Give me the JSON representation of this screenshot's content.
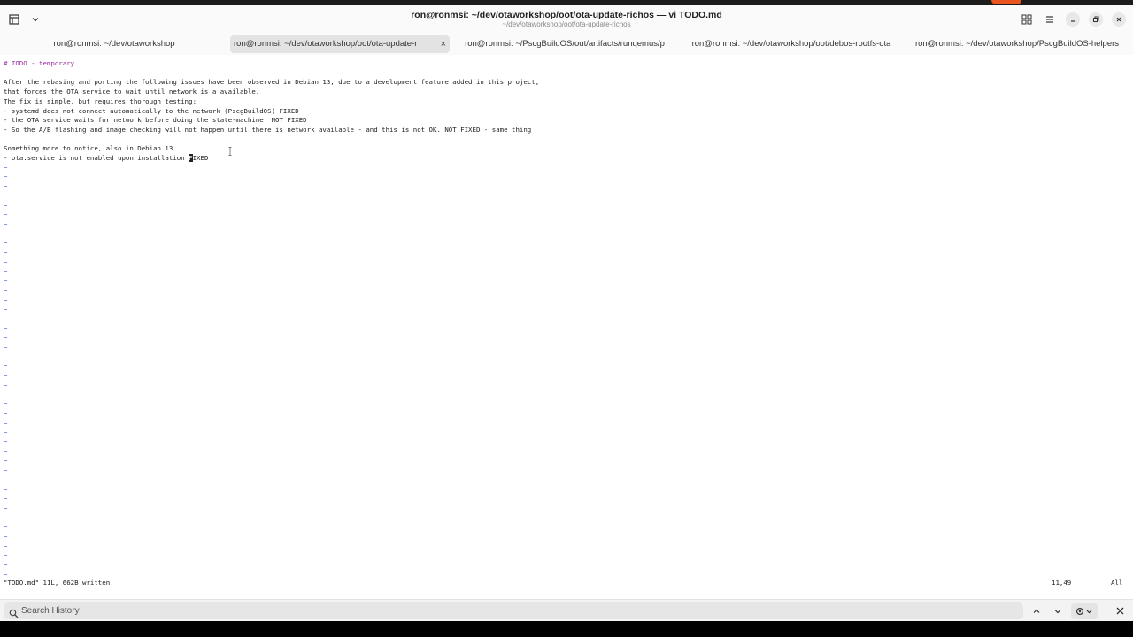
{
  "window": {
    "title": "ron@ronmsi: ~/dev/otaworkshop/oot/ota-update-richos — vi TODO.md",
    "subtitle": "~/dev/otaworkshop/oot/ota-update-richos",
    "accent_color": "#e9541f"
  },
  "tabs": [
    {
      "label": "ron@ronmsi: ~/dev/otaworkshop",
      "active": false
    },
    {
      "label": "ron@ronmsi: ~/dev/otaworkshop/oot/ota-update-r",
      "active": true
    },
    {
      "label": "ron@ronmsi: ~/PscgBuildOS/out/artifacts/runqemus/p",
      "active": false
    },
    {
      "label": "ron@ronmsi: ~/dev/otaworkshop/oot/debos-rootfs-ota",
      "active": false
    },
    {
      "label": "ron@ronmsi: ~/dev/otaworkshop/PscgBuildOS-helpers",
      "active": false
    }
  ],
  "editor": {
    "lines": [
      "# TODO - temporary",
      "",
      "After the rebasing and porting the following issues have been observed in Debian 13, due to a development feature added in this project,",
      "that forces the OTA service to wait until network is a available.",
      "The fix is simple, but requires thorough testing:",
      "- systemd does not connect automatically to the network (PscgBuildOS) FIXED",
      "- the OTA service waits for network before doing the state-machine  NOT FIXED",
      "- So the A/B flashing and image checking will not happen until there is network available - and this is not OK. NOT FIXED - same thing",
      "",
      "Something more to notice, also in Debian 13",
      "- ota.service is not enabled upon installation "
    ],
    "cursor_char": "F",
    "cursor_tail": "IXED",
    "tilde": "~",
    "status_message": "\"TODO.md\" 11L, 662B written",
    "cursor_position": "11,49",
    "scroll_indicator": "All",
    "heading_color": "#9b2ba0",
    "tilde_color": "#3b5cd6"
  },
  "search": {
    "placeholder": "Search History"
  }
}
